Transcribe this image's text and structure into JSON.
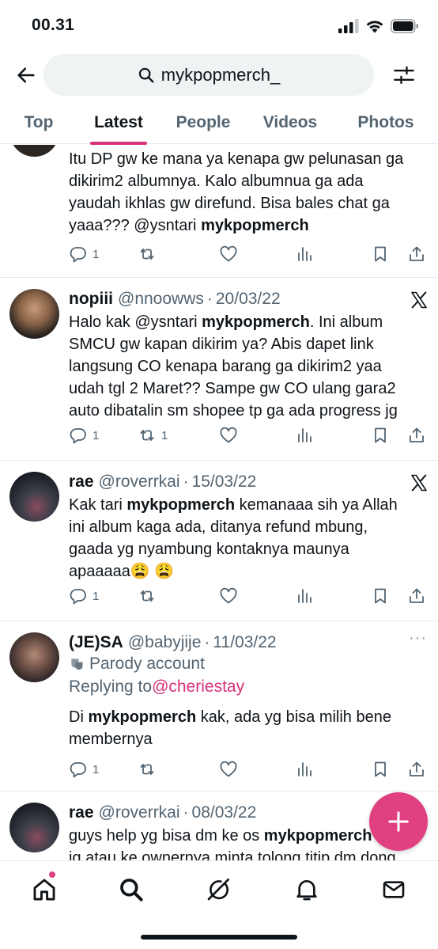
{
  "status_bar": {
    "time": "00.31"
  },
  "search": {
    "query": "mykpopmerch_"
  },
  "tabs": [
    {
      "label": "Top"
    },
    {
      "label": "Latest"
    },
    {
      "label": "People"
    },
    {
      "label": "Videos"
    },
    {
      "label": "Photos"
    }
  ],
  "tweets": [
    {
      "lines": [
        [
          "Itu DP gw ke mana ya kenapa gw pelunasan ga",
          ""
        ],
        [
          "dikirim2 albumnya. Kalo albumnua ga ada",
          ""
        ],
        [
          "yaudah ikhlas gw direfund. Bisa bales chat ga",
          ""
        ],
        [
          "yaaa??? @ysntari ",
          "mykpopmerch"
        ]
      ],
      "replies": "1",
      "reposts": ""
    },
    {
      "name": "nopiii",
      "handle": "@nnoowws",
      "dot": "·",
      "date": "20/03/22",
      "lines": [
        [
          "Halo kak @ysntari ",
          "mykpopmerch",
          ". Ini album"
        ],
        [
          "SMCU gw kapan dikirim ya? Abis dapet link",
          "",
          ""
        ],
        [
          "langsung CO kenapa barang ga dikirim2 yaa",
          "",
          ""
        ],
        [
          "udah tgl 2 Maret?? Sampe gw CO ulang gara2",
          "",
          ""
        ],
        [
          "auto dibatalin sm shopee tp ga ada progress jg",
          "",
          ""
        ]
      ],
      "replies": "1",
      "reposts": "1"
    },
    {
      "name": "rae",
      "handle": "@roverrkai",
      "dot": "·",
      "date": "15/03/22",
      "lines": [
        [
          "Kak tari ",
          "mykpopmerch",
          " kemanaaa sih ya Allah"
        ],
        [
          "ini album kaga ada, ditanya refund mbung,",
          "",
          ""
        ],
        [
          "gaada yg nyambung kontaknya maunya",
          "",
          ""
        ],
        [
          "apaaaaa😩 😩",
          "",
          ""
        ]
      ],
      "replies": "1",
      "reposts": ""
    },
    {
      "name": "(JE)SA",
      "handle": "@babyjije",
      "dot": "·",
      "date": "11/03/22",
      "more": "···",
      "parody_label": "Parody account",
      "replying_prefix": "Replying to ",
      "replying_to": "@cheriestay",
      "lines": [
        [
          "Di ",
          "mykpopmerch",
          " kak, ada yg bisa milih bene"
        ],
        [
          "membernya",
          "",
          ""
        ]
      ],
      "replies": "1",
      "reposts": ""
    },
    {
      "name": "rae",
      "handle": "@roverrkai",
      "dot": "·",
      "date": "08/03/22",
      "lines": [
        [
          "guys help yg bisa dm ke os ",
          "mykpopmerch",
          ""
        ],
        [
          "ig atau ke ownernya minta tolong titip dm dong",
          "",
          ""
        ]
      ]
    }
  ],
  "icons": {
    "back": "arrow-left-icon",
    "search": "search-icon",
    "filter": "sliders-icon",
    "reply": "reply-icon",
    "repost": "repost-icon",
    "like": "heart-icon",
    "views": "views-icon",
    "bookmark": "bookmark-icon",
    "share": "share-icon",
    "x_logo": "x-logo-icon",
    "compose": "plus-icon",
    "nav": [
      "home-icon",
      "explore-icon",
      "grok-icon",
      "bell-icon",
      "mail-icon"
    ]
  },
  "colors": {
    "accent": "#d8307a",
    "fab": "#e0407f",
    "text": "#0f1419",
    "muted": "#536471",
    "search_bg": "#eff3f4"
  }
}
